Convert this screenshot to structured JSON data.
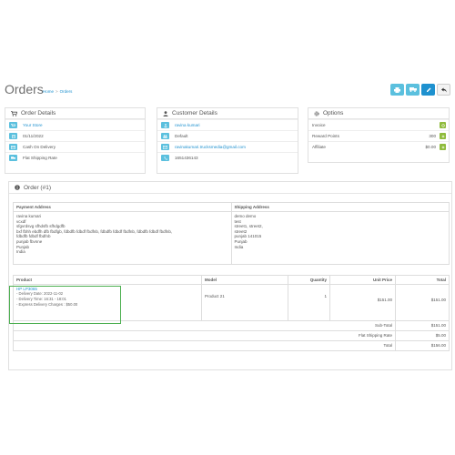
{
  "header": {
    "title": "Orders",
    "breadcrumb": [
      "Home",
      "Orders"
    ]
  },
  "order_details": {
    "heading": "Order Details",
    "store": "Your Store",
    "date": "01/11/2022",
    "payment_method": "Cash On Delivery",
    "shipping_method": "Flat Shipping Rate"
  },
  "customer_details": {
    "heading": "Customer Details",
    "name": "ravina kumari",
    "group": "Default",
    "email": "ravinakumari.trucksmedia@gmail.com",
    "phone": "1651436143"
  },
  "options": {
    "heading": "Options",
    "items": [
      {
        "label": "Invoice",
        "value": ""
      },
      {
        "label": "Reward Points",
        "value": "300"
      },
      {
        "label": "Affiliate",
        "value": "$0.00"
      }
    ]
  },
  "order": {
    "heading": "Order (#1)",
    "payment_address_label": "Payment Address",
    "shipping_address_label": "Shipping Address",
    "payment_address": [
      "ravina kumari",
      "vcxdf",
      "sfgvrdsvg sfhdsfb sfhdgdfb",
      "bxf fbhh ebdfh dfb fbdfgb, fdbdfb fdbdf fbdfnb, fdbdfb fdbdf fbdfnb, fdbdfb fdbdf fbdfnb,",
      "fdbdfb fdbdf fbdfnb",
      "punjab fbvnne",
      "Punjab",
      "India"
    ],
    "shipping_address": [
      "demo demo",
      "test",
      "street1, street2,",
      "street2",
      "punjab 141015",
      "Punjab",
      "India"
    ],
    "columns": [
      "Product",
      "Model",
      "Quantity",
      "Unit Price",
      "Total"
    ],
    "product": {
      "name": "HP LP3065",
      "options": [
        "- Delivery Date: 2022-11-02",
        "- Delivery Time: 16:31 - 18:01",
        "- Express Delivery Charges : $50.00"
      ],
      "model": "Product 21",
      "quantity": "1",
      "unit_price": "$151.00",
      "total": "$151.00"
    },
    "totals": [
      {
        "label": "Sub-Total",
        "value": "$151.00"
      },
      {
        "label": "Flat Shipping Rate",
        "value": "$5.00"
      },
      {
        "label": "Total",
        "value": "$156.00"
      }
    ]
  }
}
